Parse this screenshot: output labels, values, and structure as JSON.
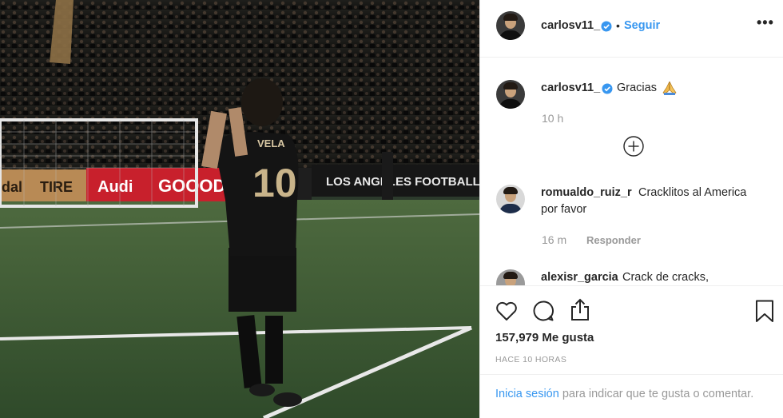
{
  "photo": {
    "jersey_name": "VELA",
    "jersey_number": "10",
    "ad_boards": [
      "dal",
      "TIRE",
      "Audi",
      "GOOOD",
      "LOS ANGELES FOOTBALL CLU"
    ]
  },
  "header": {
    "username": "carlosv11_",
    "dot": "•",
    "follow_label": "Seguir",
    "more_label": "•••"
  },
  "comments": [
    {
      "username": "carlosv11_",
      "text": "Gracias",
      "emoji": "folded-hands",
      "time": "10 h"
    },
    {
      "username": "romualdo_ruiz_r",
      "text": "Cracklitos al America",
      "text_line2": "por favor",
      "time": "16 m",
      "reply_label": "Responder"
    },
    {
      "username": "alexisr_garcia",
      "text": "Crack de cracks,"
    }
  ],
  "actions": {
    "likes": "157,979 Me gusta",
    "posted": "HACE 10 HORAS"
  },
  "login": {
    "link": "Inicia sesión",
    "text": " para indicar que te gusta o comentar."
  },
  "colors": {
    "link": "#3897f0",
    "muted": "#999999",
    "verified": "#3897f0",
    "border": "#efefef"
  }
}
